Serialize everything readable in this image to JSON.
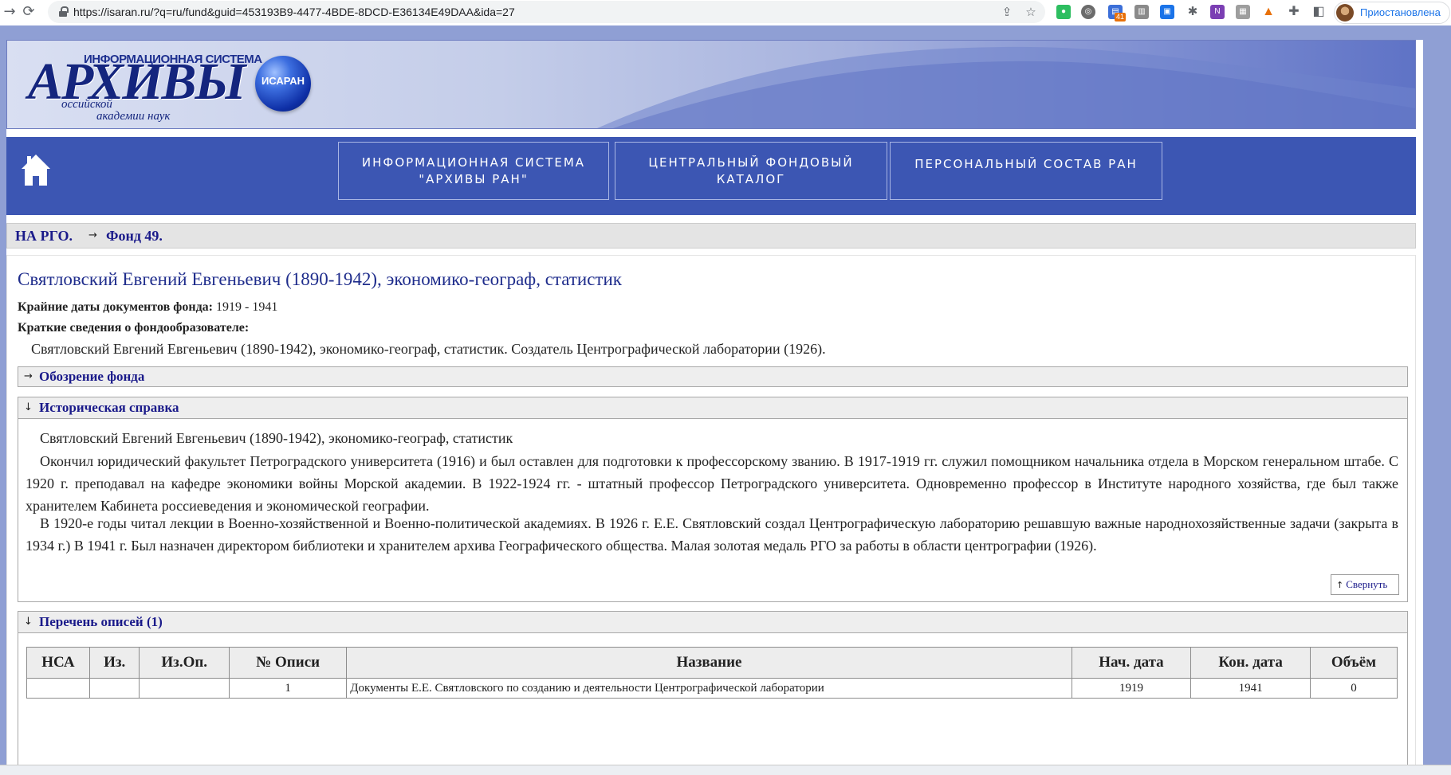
{
  "browser": {
    "url": "https://isaran.ru/?q=ru/fund&guid=453193B9-4477-4BDE-8DCD-E36134E49DAA&ida=27",
    "extension_badge": "41",
    "profile_label": "Приостановлена"
  },
  "header": {
    "logo_system": "ИНФОРМАЦИОННАЯ СИСТЕМА",
    "logo_main": "АРХИВЫ",
    "logo_sub1": "оссийской",
    "logo_sub2": "академии наук",
    "logo_badge": "ИСАРАН"
  },
  "nav": {
    "items": [
      {
        "line1": "ИНФОРМАЦИОННАЯ СИСТЕМА",
        "line2": "\"АРХИВЫ РАН\""
      },
      {
        "line1": "ЦЕНТРАЛЬНЫЙ ФОНДОВЫЙ",
        "line2": "КАТАЛОГ"
      },
      {
        "line1": "ПЕРСОНАЛЬНЫЙ СОСТАВ РАН",
        "line2": ""
      }
    ]
  },
  "breadcrumb": {
    "items": [
      "НА РГО.",
      "Фонд 49."
    ],
    "separator": "→"
  },
  "fund": {
    "title": "Святловский Евгений Евгеньевич (1890-1942), экономико-географ, статистик",
    "dates_label": "Крайние даты документов фонда:",
    "dates_value": "1919 - 1941",
    "creator_label": "Краткие сведения о фондообразователе:",
    "creator_text": "Святловский Евгений Евгеньевич (1890-1942), экономико-географ, статистик. Создатель Центрографической лаборатории (1926)."
  },
  "sections": {
    "overview": {
      "marker": "→",
      "label": "Обозрение фонда"
    },
    "history": {
      "marker": "↓",
      "label": "Историческая справка",
      "p1": "Святловский Евгений Евгеньевич (1890-1942), экономико-географ, статистик",
      "p2": "Окончил юридический факультет Петроградского университета (1916) и был оставлен для подготовки к профессорскому званию. В 1917-1919 гг. служил помощником начальника отдела в Морском генеральном штабе. С 1920 г. преподавал на кафедре экономики войны Морской академии. В 1922-1924 гг. - штатный профессор Петроградского университета. Одновременно профессор в Институте народного хозяйства, где был также хранителем Кабинета россиеведения и экономической географии.",
      "p3": "В 1920-е годы читал лекции в Военно-хозяйственной и Военно-политической академиях. В 1926 г. Е.Е. Святловский создал Центрографическую лабораторию решавшую важные народнохозяйственные задачи (закрыта в 1934 г.) В 1941 г. Был назначен директором библиотеки и хранителем архива Географического общества. Малая золотая медаль РГО за работы в области центрографии (1926).",
      "collapse_icon": "↑",
      "collapse_label": "Свернуть"
    },
    "inventories": {
      "marker": "↓",
      "label": "Перечень описей (1)",
      "columns": [
        "НСА",
        "Из.",
        "Из.Оп.",
        "№ Описи",
        "Название",
        "Нач. дата",
        "Кон. дата",
        "Объём"
      ],
      "rows": [
        [
          "",
          "",
          "",
          "1",
          "Документы Е.Е. Святловского по созданию и деятельности Центрографической лаборатории",
          "1919",
          "1941",
          "0"
        ]
      ]
    }
  }
}
